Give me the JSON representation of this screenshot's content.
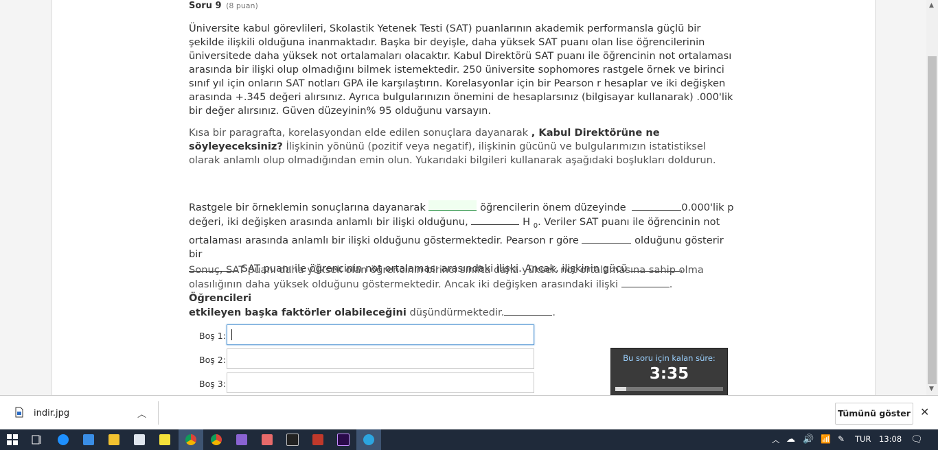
{
  "question": {
    "title": "Soru 9",
    "points": "(8 puan)",
    "paragraph1": "Üniversite kabul görevlileri, Skolastik Yetenek Testi (SAT) puanlarının akademik performansla güçlü bir şekilde ilişkili olduğuna inanmaktadır. Başka bir deyişle, daha yüksek SAT puanı olan lise öğrencilerinin üniversitede daha yüksek not ortalamaları olacaktır. Kabul Direktörü SAT puanı ile öğrencinin not ortalaması arasında bir ilişki olup olmadığını bilmek istemektedir. 250 üniversite sophomores rastgele örnek ve birinci sınıf yıl için onların SAT notları GPA ile karşılaştırın. Korelasyonlar için bir Pearson r hesaplar ve iki değişken arasında +.345 değeri alırsınız. Ayrıca bulgularınızın önemini de hesaplarsınız (bilgisayar kullanarak) .000'lik bir değer alırsınız. Güven düzeyinin% 95 olduğunu varsayın.",
    "paragraph2_a": "Kısa bir paragrafta, korelasyondan elde edilen sonuçlara dayanarak ",
    "paragraph2_bold": ", Kabul Direktörüne ne söyleyeceksiniz?",
    "paragraph2_b": "İlişkinin yönünü (pozitif veya negatif), ilişkinin gücünü ve bulgularımızın istatistiksel olarak anlamlı olup olmadığından emin olun. Yukarıdaki bilgileri kullanarak aşağıdaki boşlukları doldurun.",
    "p3": {
      "s1": "Rastgele bir örneklemin sonuçlarına dayanarak ",
      "s2": " öğrencilerin önem düzeyinde ",
      "s3": "0.000'lik p",
      "s4": "değeri, iki değişken arasında anlamlı bir ilişki olduğunu, ",
      "s5": " H ",
      "s5sub": "0",
      "s6": ". Veriler SAT puanı ile öğrencinin not",
      "s7": "ortalaması arasında anlamlı bir ilişki olduğunu göstermektedir. Pearson r göre ",
      "s8": " olduğunu gösterir bir",
      "s9": " SAT puanı ile öğrencinin not ortalaması arasındaki ilişki. Ancak, ilişkinin gücü ",
      "s10": "."
    },
    "p4": {
      "s1": "Sonuç, SAT puanı daha yüksek olan öğrencinin birinci sınıfta daha yüksek not ortalamasına sahip olma",
      "s2": "olasılığının daha yüksek olduğunu göstermektedir. Ancak iki değişken arasındaki ilişki ",
      "s3": ". ",
      "bold1": "Öğrencileri",
      "bold2": "etkileyen başka faktörler olabileceğini",
      "s4": "  düşündürmektedir.",
      "s5": "."
    }
  },
  "inputs": [
    {
      "label": "Boş 1:",
      "value": ""
    },
    {
      "label": "Boş 2:",
      "value": ""
    },
    {
      "label": "Boş 3:",
      "value": ""
    }
  ],
  "timer": {
    "caption": "Bu soru için kalan süre:",
    "time": "3:35",
    "progress": 0.1
  },
  "download": {
    "filename": "indir.jpg",
    "show_all": "Tümünü göster"
  },
  "tray": {
    "lang": "TUR",
    "time": "13:08"
  }
}
